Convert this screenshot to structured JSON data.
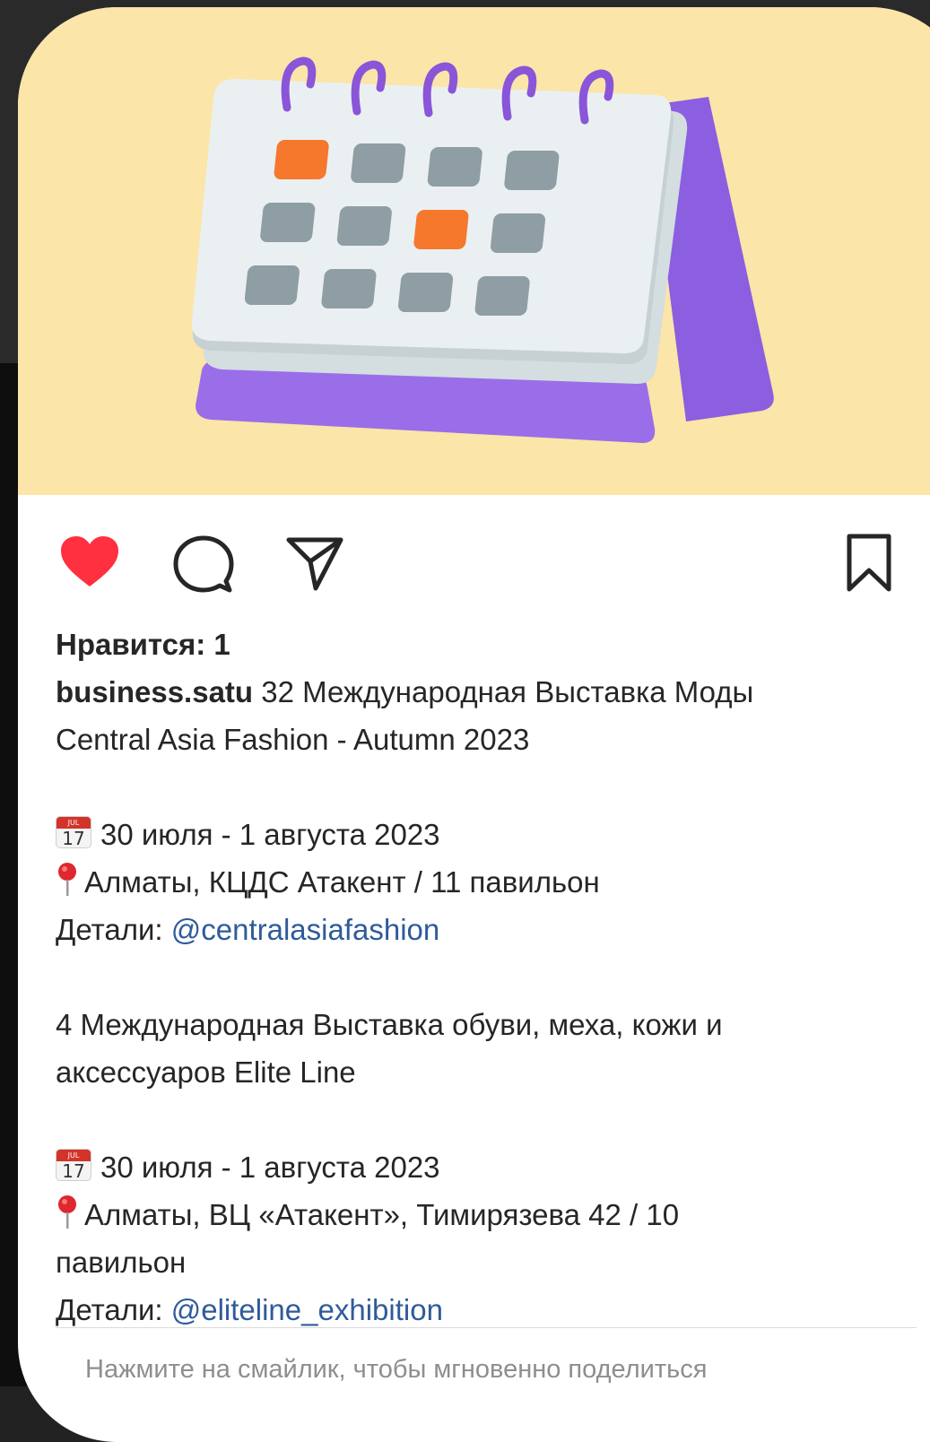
{
  "post": {
    "likes_text": "Нравится: 1",
    "username": "business.satu",
    "caption": {
      "title_line1": " 32 Международная Выставка Моды",
      "title_line2": "Central Asia Fashion - Autumn 2023",
      "event1_date": "30 июля - 1 августа 2023",
      "event1_place": "Алматы, КЦДС Атакент / 11 павильон",
      "event1_details_label": "Детали: ",
      "event1_details_link": "@centralasiafashion",
      "event2_title_line1": "4 Международная Выставка обуви, меха, кожи и",
      "event2_title_line2": "аксессуаров Elite Line",
      "event2_date": "30 июля - 1 августа 2023",
      "event2_place_line1": "Алматы, ВЦ «Атакент», Тимирязева 42 / 10",
      "event2_place_line2": "павильон",
      "event2_details_label": "Детали: ",
      "event2_details_link": "@eliteline_exhibition"
    },
    "emoji_calendar": {
      "month": "JUL",
      "day": "17"
    },
    "comment_hint": "Нажмите на смайлик, чтобы мгновенно поделиться"
  },
  "actions": {
    "like_icon": "heart-filled-icon",
    "comment_icon": "comment-bubble-icon",
    "share_icon": "paper-plane-icon",
    "save_icon": "bookmark-icon"
  },
  "colors": {
    "image_background": "#fbe5a8",
    "calendar_purple": "#9767e4",
    "calendar_page": "#e8eef0",
    "date_cell": "#8f9ea4",
    "date_cell_accent": "#f6782d",
    "like_red": "#ff3040",
    "link_blue": "#2f5b9a"
  }
}
